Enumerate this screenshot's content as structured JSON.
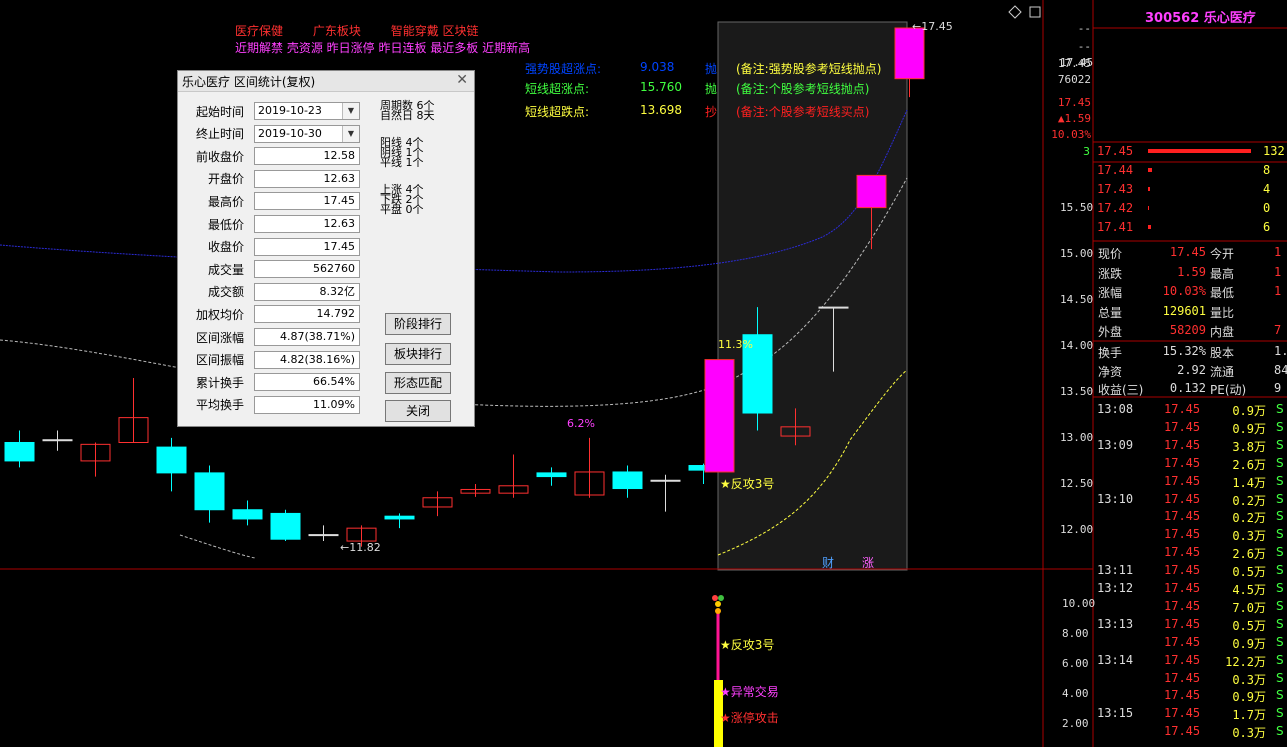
{
  "stock": {
    "code_name": "300562 乐心医疗",
    "price_axis_top": "17.45"
  },
  "tags_row1": [
    {
      "text": "医疗保健",
      "color": "#ff3030"
    },
    {
      "text": "广东板块",
      "color": "#ff3030"
    },
    {
      "text": "智能穿戴 区块链",
      "color": "#ff3030"
    }
  ],
  "tags_row2": "近期解禁 壳资源 昨日涨停 昨日连板 最近多板 近期新高",
  "indicators": [
    {
      "label": "强势股超涨点:",
      "value": "9.038",
      "cut": "抛",
      "note": "(备注:强势股参考短线抛点)",
      "color": "#0044ff",
      "note_color": "#ffff40"
    },
    {
      "label": "短线超涨点:",
      "value": "15.760",
      "cut": "抛",
      "note": "(备注:个股参考短线抛点)",
      "color": "#40ff40",
      "note_color": "#40ff40"
    },
    {
      "label": "短线超跌点:",
      "value": "13.698",
      "cut": "抄",
      "note": "(备注:个股参考短线买点)",
      "color": "#ffff40",
      "note_color": "#ff2020"
    }
  ],
  "chart_data": {
    "type": "candlestick",
    "y_range": [
      11.3,
      18.0
    ],
    "candles": [
      {
        "o": 12.95,
        "c": 12.75,
        "h": 13.08,
        "l": 12.68
      },
      {
        "o": 12.98,
        "c": 12.98,
        "h": 13.08,
        "l": 12.86
      },
      {
        "o": 12.75,
        "c": 12.93,
        "h": 12.95,
        "l": 12.58
      },
      {
        "o": 12.95,
        "c": 13.22,
        "h": 13.65,
        "l": 12.95
      },
      {
        "o": 12.9,
        "c": 12.62,
        "h": 13.0,
        "l": 12.42
      },
      {
        "o": 12.62,
        "c": 12.22,
        "h": 12.7,
        "l": 12.08
      },
      {
        "o": 12.22,
        "c": 12.12,
        "h": 12.32,
        "l": 12.05
      },
      {
        "o": 12.18,
        "c": 11.9,
        "h": 12.22,
        "l": 11.88
      },
      {
        "o": 11.95,
        "c": 11.95,
        "h": 12.05,
        "l": 11.88
      },
      {
        "o": 11.88,
        "c": 12.02,
        "h": 12.05,
        "l": 11.82
      },
      {
        "o": 12.15,
        "c": 12.12,
        "h": 12.18,
        "l": 12.02
      },
      {
        "o": 12.25,
        "c": 12.35,
        "h": 12.42,
        "l": 12.15
      },
      {
        "o": 12.4,
        "c": 12.44,
        "h": 12.5,
        "l": 12.36
      },
      {
        "o": 12.4,
        "c": 12.48,
        "h": 12.82,
        "l": 12.35
      },
      {
        "o": 12.62,
        "c": 12.58,
        "h": 12.68,
        "l": 12.48
      },
      {
        "o": 12.38,
        "c": 12.63,
        "h": 13.0,
        "l": 12.35
      },
      {
        "o": 12.63,
        "c": 12.45,
        "h": 12.7,
        "l": 12.35
      },
      {
        "o": 12.54,
        "c": 12.54,
        "h": 12.6,
        "l": 12.2
      },
      {
        "o": 12.7,
        "c": 12.65,
        "h": 12.72,
        "l": 12.5
      },
      {
        "o": 12.63,
        "c": 13.85,
        "h": 13.85,
        "l": 12.63
      },
      {
        "o": 14.12,
        "c": 13.27,
        "h": 14.42,
        "l": 13.08
      },
      {
        "o": 13.02,
        "c": 13.12,
        "h": 13.32,
        "l": 12.92
      },
      {
        "o": 14.42,
        "c": 14.42,
        "h": 14.42,
        "l": 13.72
      },
      {
        "o": 15.5,
        "c": 15.85,
        "h": 15.85,
        "l": 15.05
      },
      {
        "o": 16.9,
        "c": 17.45,
        "h": 17.45,
        "l": 16.7
      }
    ],
    "labels": {
      "low_mark": "11.82",
      "high_mark": "17.45",
      "pct1": "6.2%",
      "pct2": "11.3%",
      "signal": "★反攻3号"
    },
    "axis_ticks": [
      "17.45",
      "15.50",
      "15.00",
      "14.50",
      "14.00",
      "13.50",
      "13.00",
      "12.50",
      "12.00"
    ],
    "sub_axis_ticks": [
      "10.00",
      "8.00",
      "6.00",
      "4.00",
      "2.00"
    ],
    "sub_signals": [
      "★反攻3号",
      "★异常交易",
      "★涨停攻击"
    ],
    "bottom_tags": [
      "财",
      "涨"
    ]
  },
  "dialog": {
    "title": "乐心医疗 区间统计(复权)",
    "fields": [
      {
        "label": "起始时间",
        "value": "2019-10-23",
        "select": true
      },
      {
        "label": "终止时间",
        "value": "2019-10-30",
        "select": true
      },
      {
        "label": "前收盘价",
        "value": "12.58"
      },
      {
        "label": "开盘价",
        "value": "12.63"
      },
      {
        "label": "最高价",
        "value": "17.45"
      },
      {
        "label": "最低价",
        "value": "12.63"
      },
      {
        "label": "收盘价",
        "value": "17.45"
      },
      {
        "label": "成交量",
        "value": "562760"
      },
      {
        "label": "成交额",
        "value": "8.32亿"
      },
      {
        "label": "加权均价",
        "value": "14.792"
      },
      {
        "label": "区间涨幅",
        "value": "4.87(38.71%)"
      },
      {
        "label": "区间振幅",
        "value": "4.82(38.16%)"
      },
      {
        "label": "累计换手",
        "value": "66.54%"
      },
      {
        "label": "平均换手",
        "value": "11.09%"
      }
    ],
    "stats": [
      [
        "周期数 6个",
        "自然日 8天"
      ],
      [
        "阳线 4个",
        "阴线 1个",
        "平线 1个"
      ],
      [
        "上涨 4个",
        "下跌 2个",
        "平盘 0个"
      ]
    ],
    "buttons": [
      "阶段排行",
      "板块排行",
      "形态匹配",
      "关闭"
    ]
  },
  "right_panel": {
    "top_values": [
      "--",
      "--",
      "17.45",
      "76022",
      "17.45",
      "▲1.59",
      "10.03%"
    ],
    "order_book": {
      "marker": "3",
      "rows": [
        {
          "price": "17.45",
          "vol": "132",
          "bar": 100
        },
        {
          "price": "17.44",
          "vol": "8",
          "bar": 4
        },
        {
          "price": "17.43",
          "vol": "4",
          "bar": 2
        },
        {
          "price": "17.42",
          "vol": "0",
          "bar": 1
        },
        {
          "price": "17.41",
          "vol": "6",
          "bar": 3
        }
      ]
    },
    "quote": [
      {
        "k1": "现价",
        "v1": "17.45",
        "k2": "今开",
        "v2": "1",
        "c1": "#ff3030"
      },
      {
        "k1": "涨跌",
        "v1": "1.59",
        "k2": "最高",
        "v2": "1",
        "c1": "#ff3030"
      },
      {
        "k1": "涨幅",
        "v1": "10.03%",
        "k2": "最低",
        "v2": "1",
        "c1": "#ff3030"
      },
      {
        "k1": "总量",
        "v1": "129601",
        "k2": "量比",
        "v2": "",
        "c1": "#ffff40"
      },
      {
        "k1": "外盘",
        "v1": "58209",
        "k2": "内盘",
        "v2": "7",
        "c1": "#ff3030"
      }
    ],
    "quote2": [
      {
        "k1": "换手",
        "v1": "15.32%",
        "k2": "股本",
        "v2": "1."
      },
      {
        "k1": "净资",
        "v1": "2.92",
        "k2": "流通",
        "v2": "84"
      },
      {
        "k1": "收益(三)",
        "v1": "0.132",
        "k2": "PE(动)",
        "v2": "9"
      }
    ],
    "ticks": [
      {
        "t": "13:08",
        "p": "17.45",
        "v": "0.9万",
        "s": "S"
      },
      {
        "t": "",
        "p": "17.45",
        "v": "0.9万",
        "s": "S"
      },
      {
        "t": "13:09",
        "p": "17.45",
        "v": "3.8万",
        "s": "S"
      },
      {
        "t": "",
        "p": "17.45",
        "v": "2.6万",
        "s": "S"
      },
      {
        "t": "",
        "p": "17.45",
        "v": "1.4万",
        "s": "S"
      },
      {
        "t": "13:10",
        "p": "17.45",
        "v": "0.2万",
        "s": "S"
      },
      {
        "t": "",
        "p": "17.45",
        "v": "0.2万",
        "s": "S"
      },
      {
        "t": "",
        "p": "17.45",
        "v": "0.3万",
        "s": "S"
      },
      {
        "t": "",
        "p": "17.45",
        "v": "2.6万",
        "s": "S"
      },
      {
        "t": "13:11",
        "p": "17.45",
        "v": "0.5万",
        "s": "S"
      },
      {
        "t": "13:12",
        "p": "17.45",
        "v": "4.5万",
        "s": "S"
      },
      {
        "t": "",
        "p": "17.45",
        "v": "7.0万",
        "s": "S"
      },
      {
        "t": "13:13",
        "p": "17.45",
        "v": "0.5万",
        "s": "S"
      },
      {
        "t": "",
        "p": "17.45",
        "v": "0.9万",
        "s": "S"
      },
      {
        "t": "13:14",
        "p": "17.45",
        "v": "12.2万",
        "s": "S"
      },
      {
        "t": "",
        "p": "17.45",
        "v": "0.3万",
        "s": "S"
      },
      {
        "t": "",
        "p": "17.45",
        "v": "0.9万",
        "s": "S"
      },
      {
        "t": "13:15",
        "p": "17.45",
        "v": "1.7万",
        "s": "S"
      },
      {
        "t": "",
        "p": "17.45",
        "v": "0.3万",
        "s": "S"
      }
    ]
  },
  "colors": {
    "up": "#ff3030",
    "down": "#00ffff",
    "limit": "#ff00ff",
    "grid": "#aa0000"
  }
}
